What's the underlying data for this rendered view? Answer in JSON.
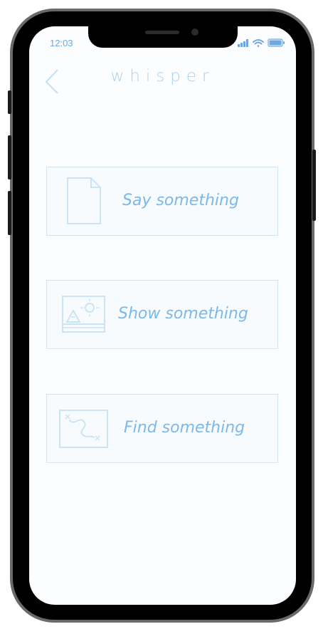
{
  "status_bar": {
    "time": "12:03",
    "signal_icon": "signal-bars-icon",
    "wifi_icon": "wifi-icon",
    "battery_icon": "battery-icon"
  },
  "header": {
    "back_icon": "chevron-left-icon",
    "title": "whisper"
  },
  "options": [
    {
      "label": "Say something",
      "icon": "document-icon"
    },
    {
      "label": "Show something",
      "icon": "image-icon"
    },
    {
      "label": "Find something",
      "icon": "map-icon"
    }
  ],
  "colors": {
    "accent": "#7cb8e8",
    "title": "#a9d2f1",
    "card_border": "#cfe4f3",
    "card_background": "#f7fbfe",
    "icon_stroke": "#c9e5f5",
    "status": "#6ea8dd"
  }
}
